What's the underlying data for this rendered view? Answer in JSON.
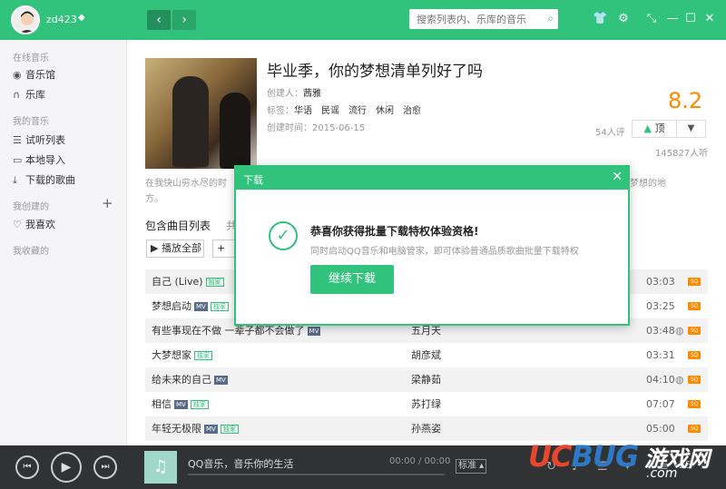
{
  "header": {
    "username": "zd423",
    "search_placeholder": "搜索列表内、乐库的音乐"
  },
  "sidebar": {
    "online_section": "在线音乐",
    "music_hall": "音乐馆",
    "radio": "乐库",
    "my_music_section": "我的音乐",
    "trial_list": "试听列表",
    "local_import": "本地导入",
    "downloaded": "下载的歌曲",
    "created_section": "我创建的",
    "favorites": "我喜欢",
    "collected_section": "我收藏的"
  },
  "playlist": {
    "title": "毕业季，你的梦想清单列好了吗",
    "creator_label": "创建人：",
    "creator": "茜雅",
    "tags_label": "标签：",
    "tags": [
      "华语",
      "民谣",
      "流行",
      "休闲",
      "治愈"
    ],
    "created_label": "创建时间：",
    "created_date": "2015-06-15",
    "score": "8.2",
    "rating_count": "54人评",
    "up_label": "顶",
    "listens": "145827人听",
    "desc_left": "在我快山穷水尽的时",
    "desc_right": "梦想的地",
    "desc_line2": "方。",
    "tab_songs": "包含曲目列表",
    "tab_other": "共",
    "play_all": "播放全部",
    "add_label": "+"
  },
  "songs": [
    {
      "name": "自己 (Live)",
      "mv": false,
      "live": true,
      "artist": "",
      "duration": "03:03",
      "globe": false
    },
    {
      "name": "梦想启动",
      "mv": true,
      "live": true,
      "artist": "",
      "duration": "03:25",
      "globe": false
    },
    {
      "name": "有些事现在不做 一辈子都不会做了",
      "mv": true,
      "live": false,
      "artist": "五月天",
      "duration": "03:48",
      "globe": true
    },
    {
      "name": "大梦想家",
      "mv": false,
      "live": true,
      "artist": "胡彦斌",
      "duration": "03:31",
      "globe": false
    },
    {
      "name": "给未来的自己",
      "mv": true,
      "live": false,
      "artist": "梁静茹",
      "duration": "04:10",
      "globe": true
    },
    {
      "name": "相信",
      "mv": true,
      "live": true,
      "artist": "苏打绿",
      "duration": "07:07",
      "globe": false
    },
    {
      "name": "年轻无极限",
      "mv": true,
      "live": true,
      "artist": "孙燕姿",
      "duration": "05:00",
      "globe": false
    }
  ],
  "badges": {
    "mv": "MV",
    "live": "独家",
    "sq": "SQ"
  },
  "player": {
    "now_playing": "QQ音乐，音乐你的生活",
    "time": "00:00 / 00:00",
    "quality": "标准",
    "list_count": "25"
  },
  "dialog": {
    "title": "下载",
    "heading": "恭喜你获得批量下载特权体验资格!",
    "sub": "同时启动QQ音乐和电脑管家，即可体验普通品质歌曲批量下载特权",
    "button": "继续下载"
  },
  "watermark": {
    "brand_main": "UCBUG",
    "brand_cn": "游戏网",
    "domain": ".com"
  },
  "colors": {
    "accent": "#31c27c",
    "score": "#ff8a00",
    "player_bg": "#303234"
  }
}
